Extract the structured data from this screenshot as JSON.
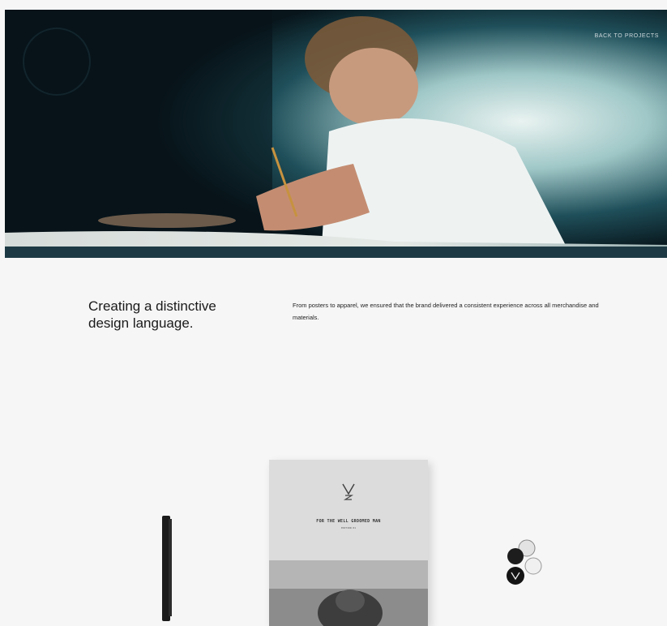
{
  "hero": {
    "back_link": "BACK TO PROJECTS"
  },
  "intro": {
    "headline": "Creating a distinctive design language.",
    "description": "From posters to apparel, we ensured that the brand delivered a consistent experience across all merchandise and materials."
  },
  "book": {
    "title": "FOR THE WELL GROOMED MAN",
    "subtitle": "EDITION 01"
  }
}
